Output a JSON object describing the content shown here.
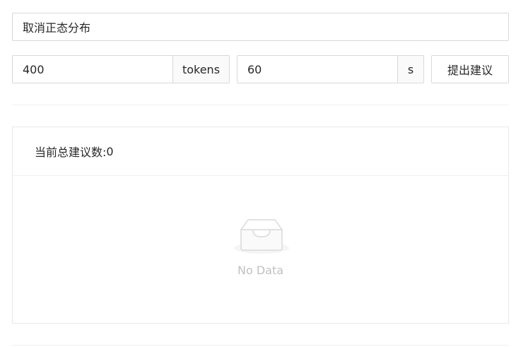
{
  "form": {
    "query_value": "取消正态分布",
    "tokens_value": "400",
    "tokens_unit": "tokens",
    "time_value": "60",
    "time_unit": "s",
    "submit_label": "提出建议"
  },
  "suggestions_card": {
    "total_label": "当前总建议数:",
    "total_count": "0",
    "empty_text": "No Data",
    "empty_icon": "empty-inbox-icon"
  }
}
